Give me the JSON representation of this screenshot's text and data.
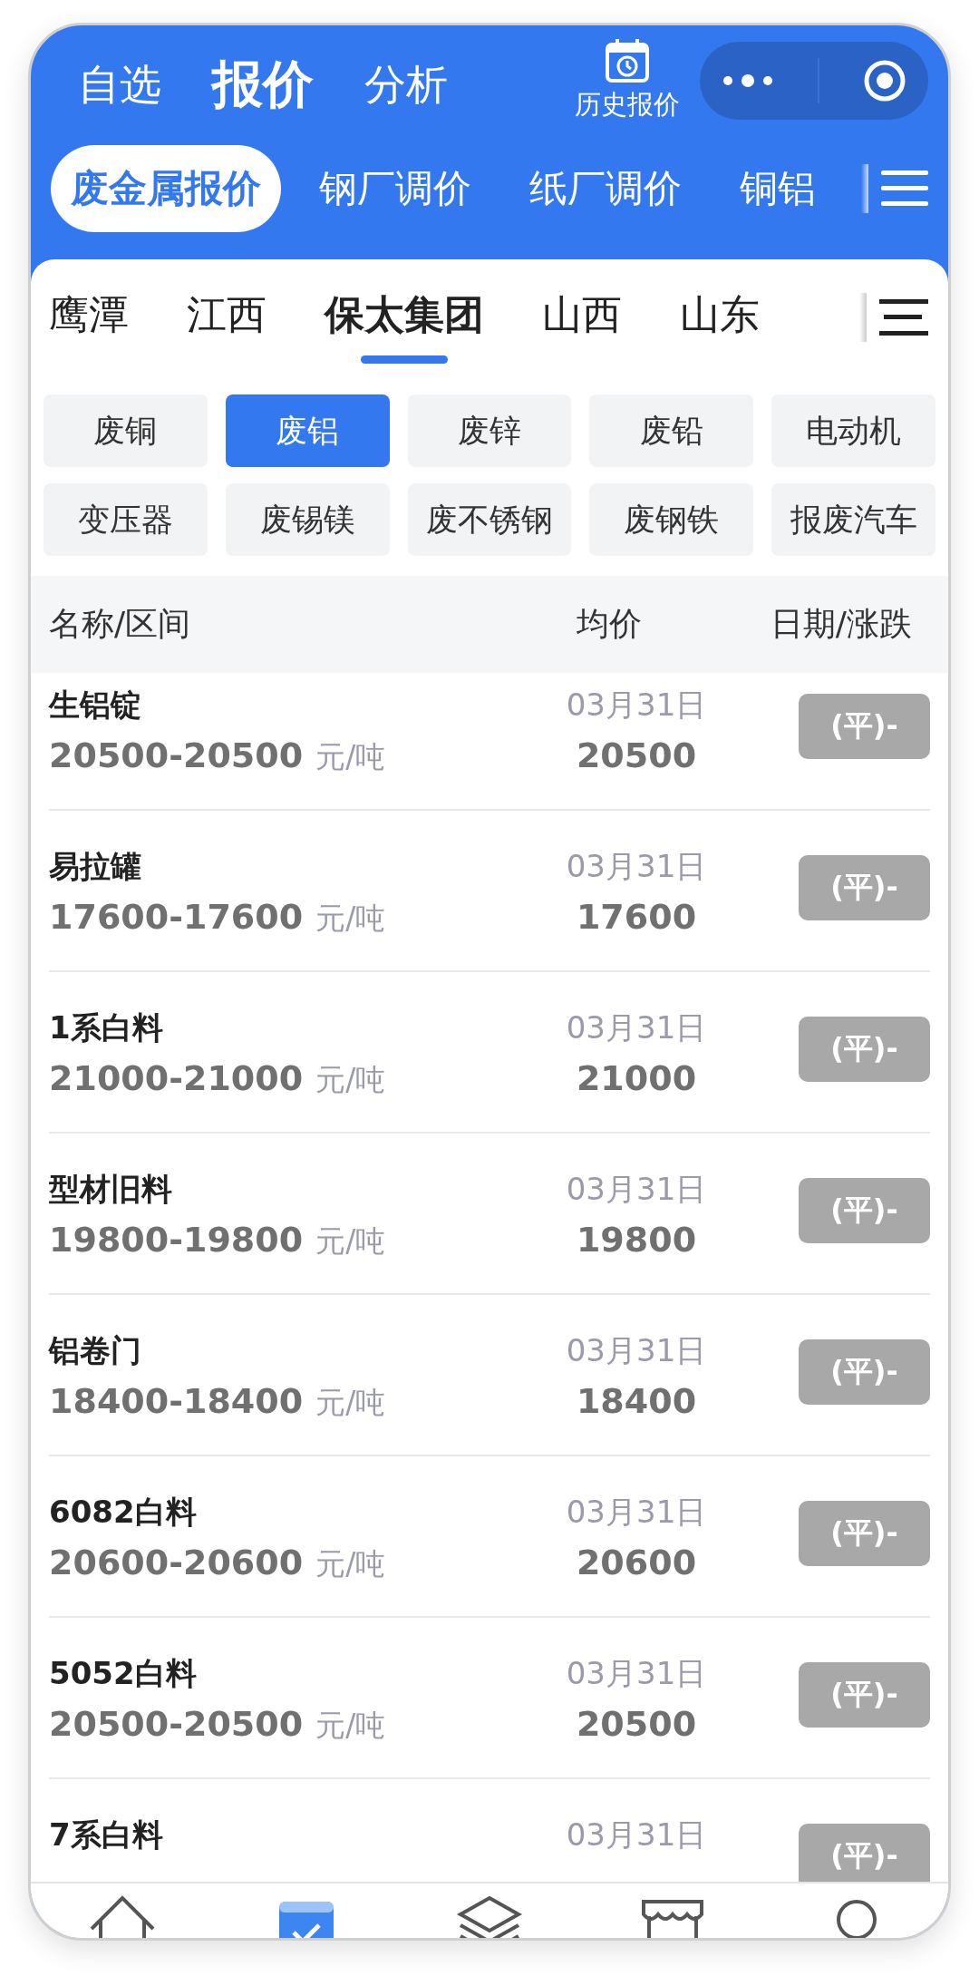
{
  "top_tabs": [
    {
      "label": "自选",
      "selected": false
    },
    {
      "label": "报价",
      "selected": true
    },
    {
      "label": "分析",
      "selected": false
    }
  ],
  "history": {
    "label": "历史报价"
  },
  "category_tabs": [
    {
      "label": "废金属报价",
      "selected": true
    },
    {
      "label": "钢厂调价",
      "selected": false
    },
    {
      "label": "纸厂调价",
      "selected": false
    },
    {
      "label": "铜铝",
      "selected": false
    }
  ],
  "region_tabs": [
    {
      "label": "鹰潭",
      "selected": false
    },
    {
      "label": "江西",
      "selected": false
    },
    {
      "label": "保太集团",
      "selected": true
    },
    {
      "label": "山西",
      "selected": false
    },
    {
      "label": "山东",
      "selected": false
    }
  ],
  "materials": [
    {
      "label": "废铜",
      "selected": false
    },
    {
      "label": "废铝",
      "selected": true
    },
    {
      "label": "废锌",
      "selected": false
    },
    {
      "label": "废铅",
      "selected": false
    },
    {
      "label": "电动机",
      "selected": false
    },
    {
      "label": "变压器",
      "selected": false
    },
    {
      "label": "废锡镁",
      "selected": false
    },
    {
      "label": "废不锈钢",
      "selected": false
    },
    {
      "label": "废钢铁",
      "selected": false
    },
    {
      "label": "报废汽车",
      "selected": false
    }
  ],
  "table": {
    "columns": [
      "名称/区间",
      "均价",
      "日期/涨跌"
    ],
    "rows": [
      {
        "name": "生铝锭",
        "range": "20500-20500",
        "unit": "元/吨",
        "date": "03月31日",
        "average": "20500",
        "change": "(平)-"
      },
      {
        "name": "易拉罐",
        "range": "17600-17600",
        "unit": "元/吨",
        "date": "03月31日",
        "average": "17600",
        "change": "(平)-"
      },
      {
        "name": "1系白料",
        "range": "21000-21000",
        "unit": "元/吨",
        "date": "03月31日",
        "average": "21000",
        "change": "(平)-"
      },
      {
        "name": "型材旧料",
        "range": "19800-19800",
        "unit": "元/吨",
        "date": "03月31日",
        "average": "19800",
        "change": "(平)-"
      },
      {
        "name": "铝卷门",
        "range": "18400-18400",
        "unit": "元/吨",
        "date": "03月31日",
        "average": "18400",
        "change": "(平)-"
      },
      {
        "name": "6082白料",
        "range": "20600-20600",
        "unit": "元/吨",
        "date": "03月31日",
        "average": "20600",
        "change": "(平)-"
      },
      {
        "name": "5052白料",
        "range": "20500-20500",
        "unit": "元/吨",
        "date": "03月31日",
        "average": "20500",
        "change": "(平)-"
      },
      {
        "name": "7系白料",
        "date": "03月31日",
        "change": "(平)-"
      }
    ]
  },
  "bottom_nav": [
    {
      "kind": "home",
      "selected": false
    },
    {
      "kind": "quote",
      "selected": true
    },
    {
      "kind": "layers",
      "selected": false
    },
    {
      "kind": "shop",
      "selected": false
    },
    {
      "kind": "profile",
      "selected": false
    }
  ]
}
